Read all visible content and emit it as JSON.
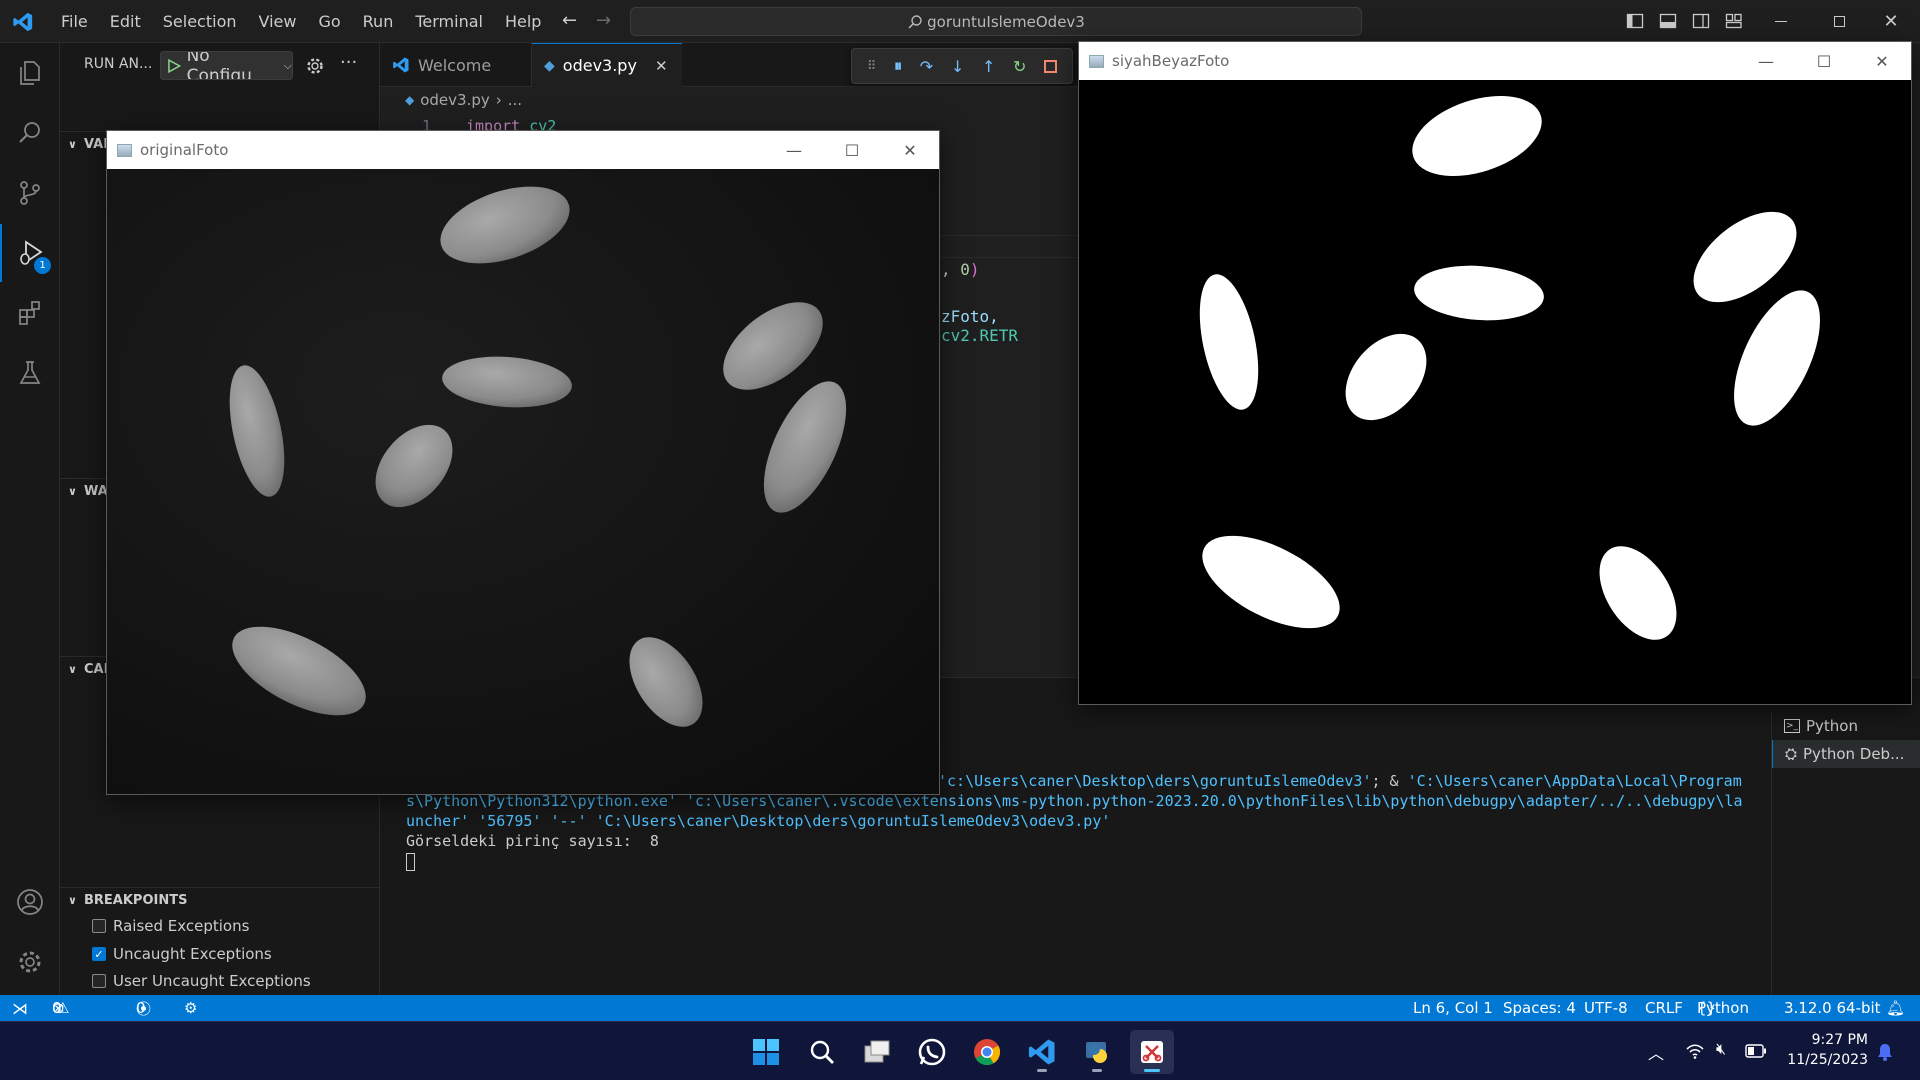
{
  "menu": [
    "File",
    "Edit",
    "Selection",
    "View",
    "Go",
    "Run",
    "Terminal",
    "Help"
  ],
  "command_center": "goruntuIslemeOdev3",
  "sidebar": {
    "run_label": "RUN AN...",
    "config": "No Configu",
    "sections": {
      "variables": "VARIABLES",
      "watch": "WA",
      "callstack": "CAL",
      "breakpoints": "BREAKPOINTS"
    },
    "breakpoints": [
      {
        "label": "Raised Exceptions",
        "checked": false
      },
      {
        "label": "Uncaught Exceptions",
        "checked": true
      },
      {
        "label": "User Uncaught Exceptions",
        "checked": false
      }
    ],
    "run_badge": "1"
  },
  "tabs": [
    {
      "label": "Welcome"
    },
    {
      "label": "odev3.py"
    }
  ],
  "editor": {
    "breadcrumb_file": "odev3.py",
    "breadcrumb_more": "...",
    "line_number": "1",
    "line1_keyword": "import",
    "line1_module": "cv2",
    "frag_a": ", ",
    "frag_a_num": "0",
    "frag_a_end": ")",
    "frag_b": "zFoto, ",
    "frag_b_cv": "cv2.RETR"
  },
  "terminal": {
    "line1_a": "'c:\\Users\\caner\\Desktop\\ders\\goruntuIslemeOdev3'",
    "line1_b": "; & ",
    "line1_c": "'C:\\Users\\caner\\AppData\\Local\\Program",
    "line2": "s\\Python\\Python312\\python.exe' 'c:\\Users\\caner\\.vscode\\extensions\\ms-python.python-2023.20.0\\pythonFiles\\lib\\python\\debugpy\\adapter/../..\\debugpy\\la",
    "line3": "uncher' '56795' '--' 'C:\\Users\\caner\\Desktop\\ders\\goruntuIslemeOdev3\\odev3.py'",
    "output": "Görseldeki pirinç sayısı:  8"
  },
  "terminal_list": [
    "Python",
    "Python Deb..."
  ],
  "windows": {
    "original": "originalFoto",
    "binary": "siyahBeyazFoto"
  },
  "status": {
    "errors": "0",
    "warnings": "0",
    "ports": "0",
    "position": "Ln 6, Col 1",
    "spaces": "Spaces: 4",
    "encoding": "UTF-8",
    "eol": "CRLF",
    "language": "Python",
    "interpreter": "3.12.0 64-bit"
  },
  "clock": {
    "time": "9:27 PM",
    "date": "11/25/2023"
  },
  "colors": {
    "accent": "#0078d4",
    "statusbar": "#0078d4",
    "taskbar": "#10163a",
    "keyword": "#c586c0",
    "number": "#b5cea8",
    "string_path": "#4fc1ff"
  },
  "icons": {
    "activity": [
      "explorer-icon",
      "search-icon",
      "source-control-icon",
      "run-debug-icon",
      "extensions-icon",
      "testing-icon",
      "account-icon",
      "settings-gear-icon"
    ]
  }
}
